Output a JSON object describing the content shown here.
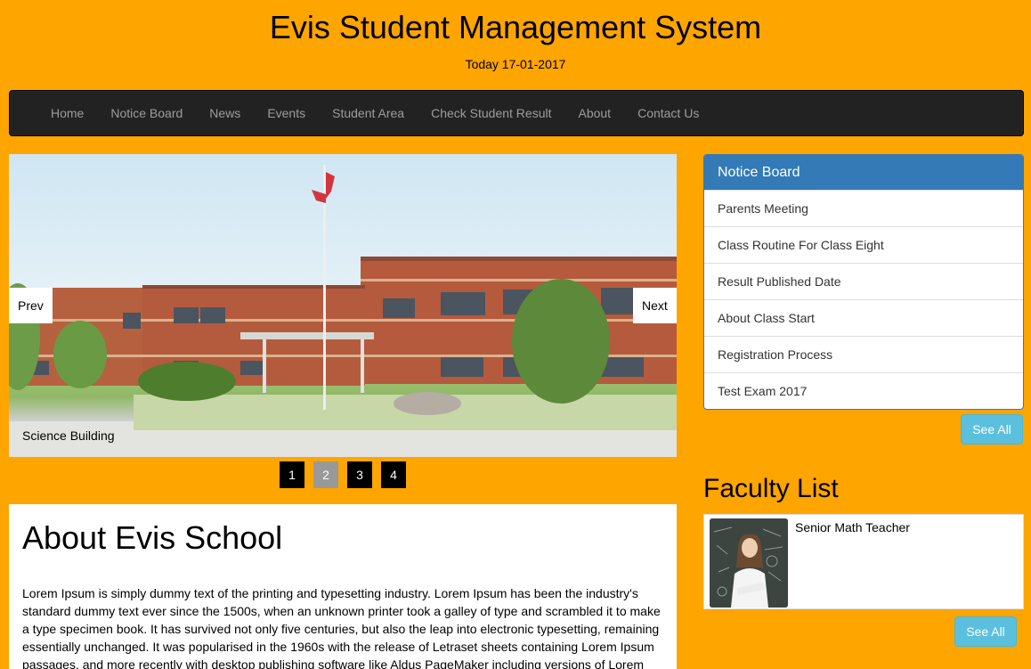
{
  "header": {
    "title": "Evis Student Management System",
    "today": "Today 17-01-2017"
  },
  "nav": {
    "items": [
      "Home",
      "Notice Board",
      "News",
      "Events",
      "Student Area",
      "Check Student Result",
      "About",
      "Contact Us"
    ]
  },
  "slider": {
    "caption": "Science Building",
    "prev_label": "Prev",
    "next_label": "Next",
    "pages": [
      "1",
      "2",
      "3",
      "4"
    ],
    "active_page": "2"
  },
  "about": {
    "title": "About Evis School",
    "text": "Lorem Ipsum is simply dummy text of the printing and typesetting industry. Lorem Ipsum has been the industry's standard dummy text ever since the 1500s, when an unknown printer took a galley of type and scrambled it to make a type specimen book. It has survived not only five centuries, but also the leap into electronic typesetting, remaining essentially unchanged. It was popularised in the 1960s with the release of Letraset sheets containing Lorem Ipsum passages, and more recently with desktop publishing software like Aldus PageMaker including versions of Lorem"
  },
  "notice_board": {
    "heading": "Notice Board",
    "items": [
      "Parents Meeting",
      "Class Routine For Class Eight",
      "Result Published Date",
      "About Class Start",
      "Registration Process",
      "Test Exam 2017"
    ],
    "see_all": "See All"
  },
  "faculty": {
    "title": "Faculty List",
    "items": [
      {
        "role": "Senior Math Teacher"
      }
    ],
    "see_all": "See All"
  },
  "colors": {
    "page_background": "#ffa500",
    "navbar": "#222222",
    "panel_heading": "#337ab7",
    "info_button": "#5bc0de"
  }
}
